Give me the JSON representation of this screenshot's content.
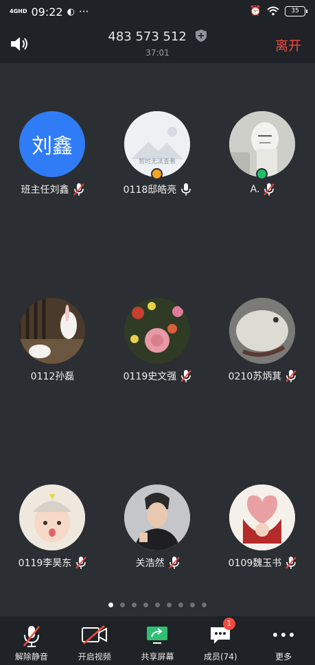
{
  "status_bar": {
    "network": "4GHD",
    "time": "09:22",
    "battery": "35"
  },
  "header": {
    "meeting_id": "483 573 512",
    "duration": "37:01",
    "leave_label": "离开"
  },
  "participants": [
    {
      "name": "班主任刘鑫",
      "avatar_text": "刘鑫",
      "mic": "muted",
      "color": "#2f7cf6"
    },
    {
      "name": "0118邸皓亮",
      "avatar_text": "暂时无法查看",
      "mic": "on"
    },
    {
      "name": "A.",
      "mic": "muted"
    },
    {
      "name": "0112孙磊",
      "mic": "none"
    },
    {
      "name": "0119史文强",
      "mic": "muted"
    },
    {
      "name": "0210苏炳萁",
      "mic": "muted"
    },
    {
      "name": "0119李昊东",
      "mic": "muted"
    },
    {
      "name": "关浩然",
      "mic": "muted"
    },
    {
      "name": "0109魏玉书",
      "mic": "muted"
    }
  ],
  "pagination": {
    "pages": 9,
    "current": 1
  },
  "toolbar": {
    "unmute": "解除静音",
    "start_video": "开启视频",
    "share_screen": "共享屏幕",
    "members": "成员(74)",
    "members_badge": "1",
    "more": "更多"
  }
}
